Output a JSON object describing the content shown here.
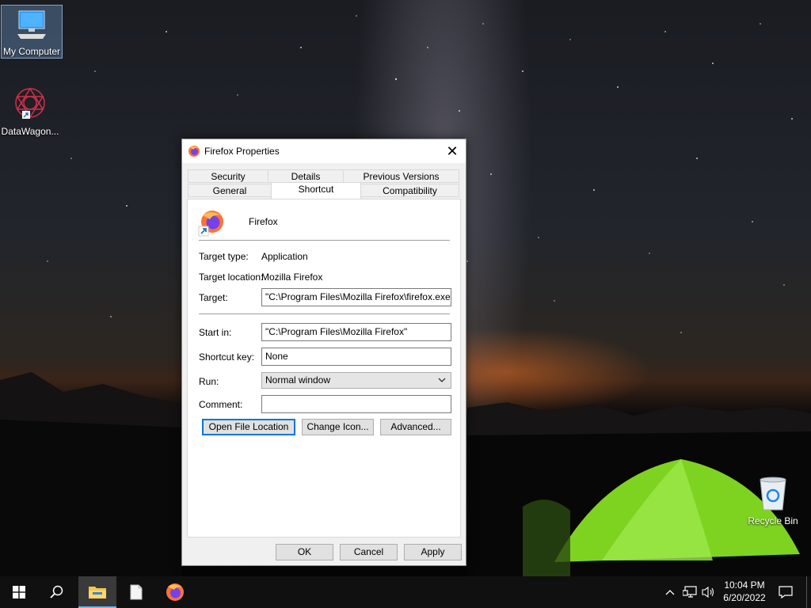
{
  "desktop": {
    "icons": [
      {
        "label": "My Computer"
      },
      {
        "label": "DataWagon..."
      },
      {
        "label": "Recycle Bin"
      }
    ]
  },
  "dialog": {
    "title": "Firefox Properties",
    "close_glyph": "✕",
    "tabs_top": [
      "Security",
      "Details",
      "Previous Versions"
    ],
    "tabs_bottom": [
      "General",
      "Shortcut",
      "Compatibility"
    ],
    "active_tab": "Shortcut",
    "app_name": "Firefox",
    "target_type_label": "Target type:",
    "target_type_value": "Application",
    "target_location_label": "Target location:",
    "target_location_value": "Mozilla Firefox",
    "target_label": "Target:",
    "target_value": "\"C:\\Program Files\\Mozilla Firefox\\firefox.exe\"",
    "start_in_label": "Start in:",
    "start_in_value": "\"C:\\Program Files\\Mozilla Firefox\"",
    "shortcut_key_label": "Shortcut key:",
    "shortcut_key_value": "None",
    "run_label": "Run:",
    "run_value": "Normal window",
    "comment_label": "Comment:",
    "comment_value": "",
    "buttons": {
      "open_file_location": "Open File Location",
      "change_icon": "Change Icon...",
      "advanced": "Advanced...",
      "ok": "OK",
      "cancel": "Cancel",
      "apply": "Apply"
    }
  },
  "taskbar": {
    "time": "10:04 PM",
    "date": "6/20/2022"
  },
  "colors": {
    "accent": "#0078d7",
    "taskbar": "#101010",
    "dialog_bg": "#f0f0f0"
  }
}
